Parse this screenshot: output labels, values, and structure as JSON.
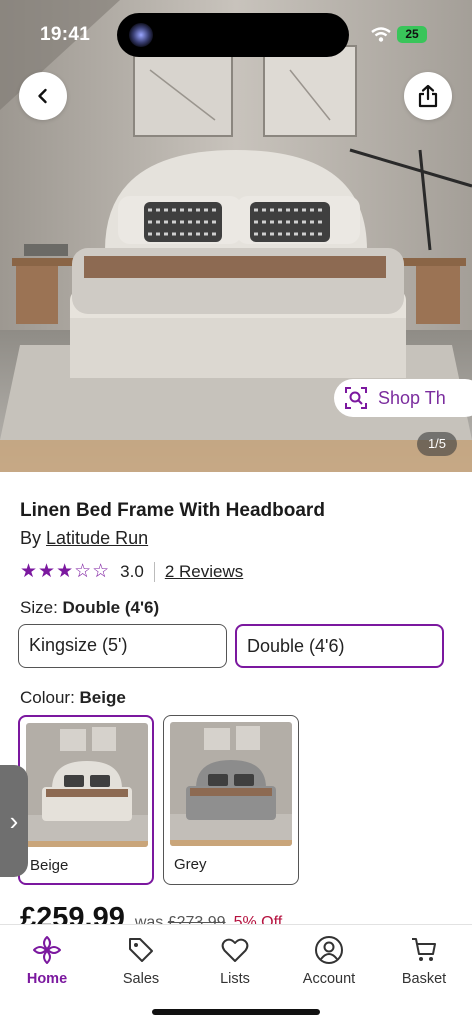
{
  "status_bar": {
    "time": "19:41",
    "battery": "25"
  },
  "hero": {
    "shop_label": "Shop Th",
    "image_counter": "1/5"
  },
  "product": {
    "title": "Linen Bed Frame With Headboard",
    "by_prefix": "By",
    "brand": "Latitude Run",
    "rating": 3,
    "rating_max": 5,
    "rating_value": "3.0",
    "reviews": "2 Reviews"
  },
  "size": {
    "label": "Size: ",
    "selected": "Double (4'6)",
    "options": [
      "Kingsize (5')",
      "Double (4'6)"
    ]
  },
  "colour": {
    "label": "Colour: ",
    "selected": "Beige",
    "options": [
      "Beige",
      "Grey"
    ]
  },
  "pricing": {
    "price": "£259.99",
    "was_label": "was",
    "was_price": "£273.99",
    "discount": "5% Off"
  },
  "nav": {
    "items": [
      {
        "label": "Home",
        "icon": "home-icon",
        "active": true
      },
      {
        "label": "Sales",
        "icon": "tag-icon"
      },
      {
        "label": "Lists",
        "icon": "heart-icon"
      },
      {
        "label": "Account",
        "icon": "account-icon"
      },
      {
        "label": "Basket",
        "icon": "cart-icon"
      }
    ]
  },
  "colors": {
    "accent": "#7b189f",
    "discount": "#b5123f"
  }
}
